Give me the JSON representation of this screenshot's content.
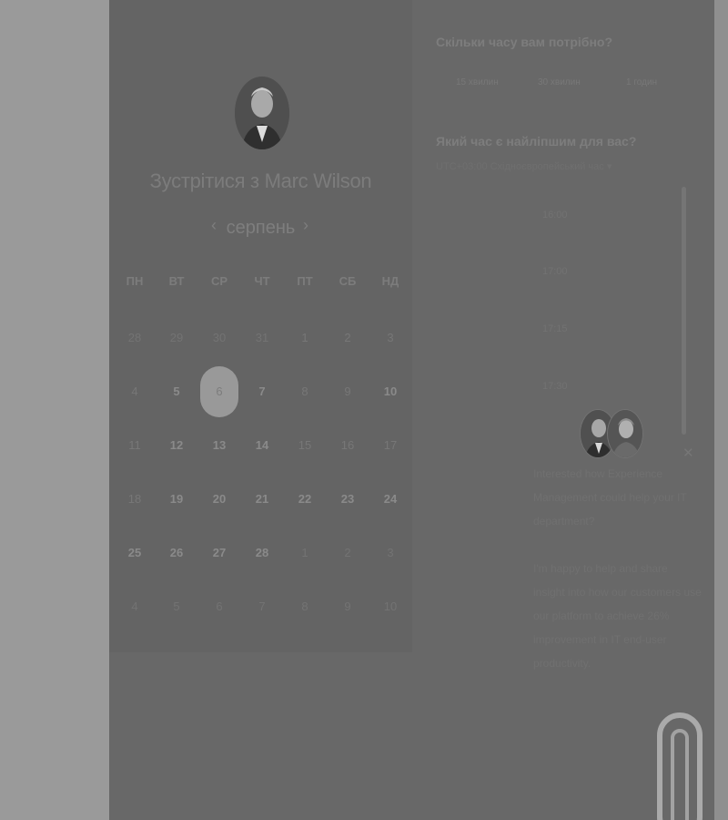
{
  "calendar": {
    "title": "Зустрітися з Marc Wilson",
    "month": "серпень",
    "weekdays": [
      "ПН",
      "ВТ",
      "СР",
      "ЧТ",
      "ПТ",
      "СБ",
      "НД"
    ],
    "weeks": [
      [
        "28",
        "29",
        "30",
        "31",
        "1",
        "2",
        "3"
      ],
      [
        "4",
        "5",
        "6",
        "7",
        "8",
        "9",
        "10"
      ],
      [
        "11",
        "12",
        "13",
        "14",
        "15",
        "16",
        "17"
      ],
      [
        "18",
        "19",
        "20",
        "21",
        "22",
        "23",
        "24"
      ],
      [
        "25",
        "26",
        "27",
        "28",
        "1",
        "2",
        "3"
      ],
      [
        "4",
        "5",
        "6",
        "7",
        "8",
        "9",
        "10"
      ]
    ],
    "selected_day": "6"
  },
  "scheduler": {
    "duration_question": "Скільки часу вам потрібно?",
    "durations": [
      "15 хвилин",
      "30 хвилин",
      "1 годин"
    ],
    "time_question": "Який час є найліпшим для вас?",
    "timezone": "UTC+03:00 Східноєвропейський час",
    "time_slots": [
      "16:00",
      "17:00",
      "17:15",
      "17:30"
    ]
  },
  "chat": {
    "message1": "Interested how Experience Management could help your IT department?",
    "message2": "I'm happy to help and share insight into how our customers use our platform to achieve 26% improvement in IT end-user productivity."
  }
}
